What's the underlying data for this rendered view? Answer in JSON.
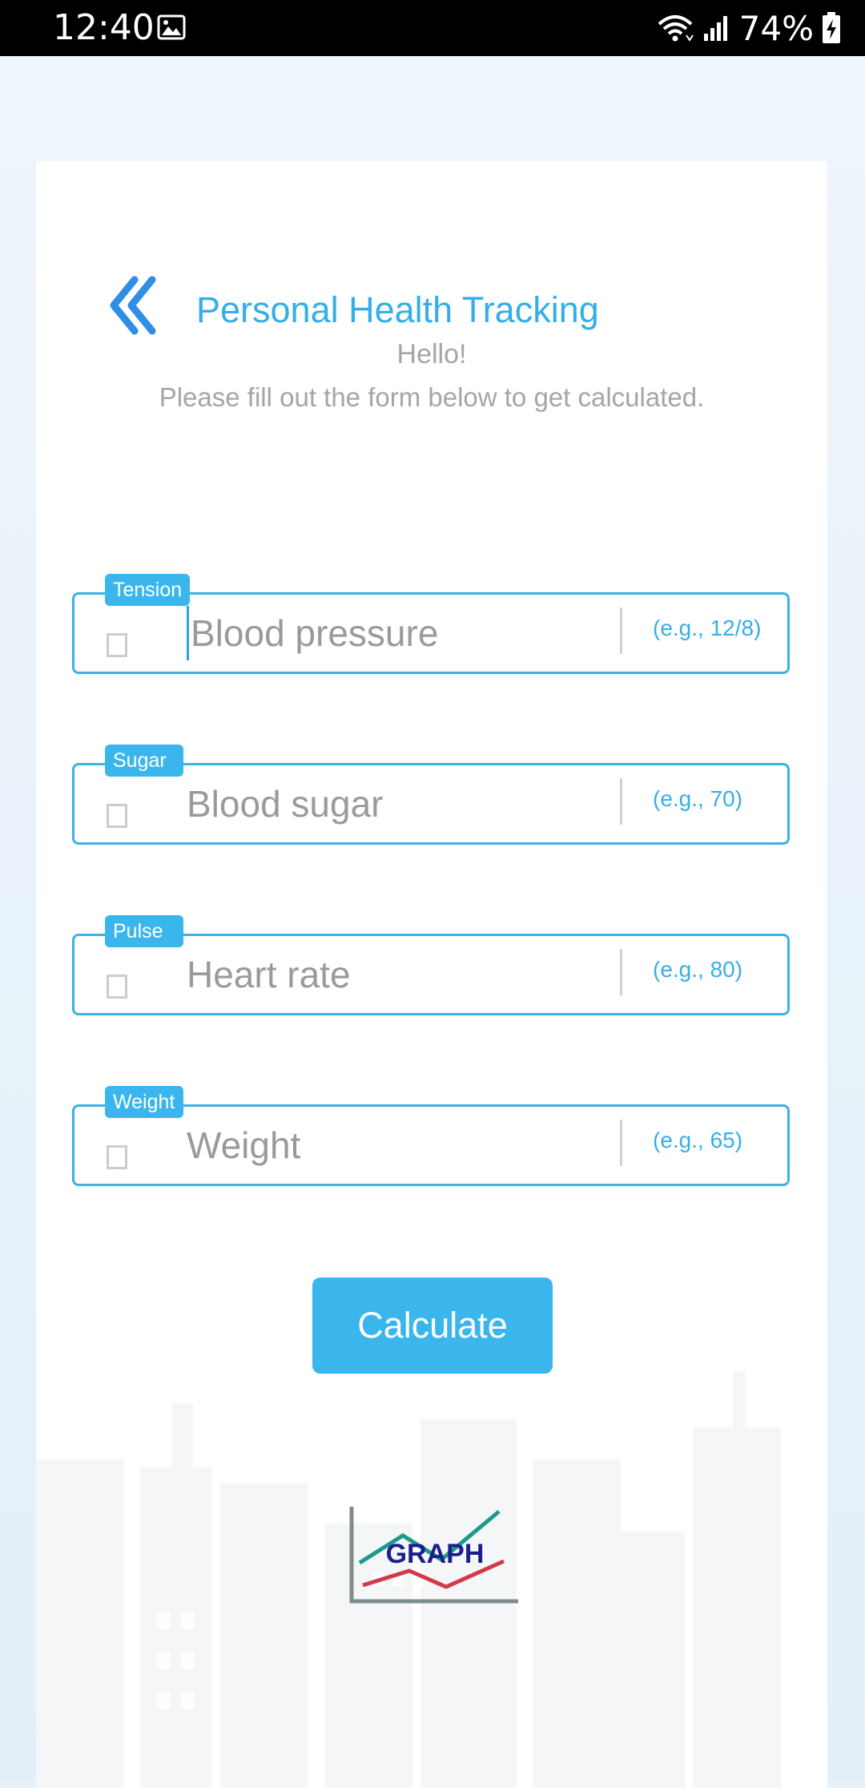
{
  "status_bar": {
    "time": "12:40",
    "battery": "74%",
    "icons": [
      "image-icon",
      "wifi-icon",
      "signal-icon",
      "battery-charging-icon"
    ]
  },
  "header": {
    "back_icon": "double-chevron-left-icon",
    "title": "Personal Health Tracking",
    "greeting": "Hello!",
    "subtitle": "Please fill out the form below to get calculated."
  },
  "form": {
    "fields": [
      {
        "tag": "Tension",
        "placeholder": "Blood pressure",
        "hint": "(e.g., 12/8)"
      },
      {
        "tag": "Sugar",
        "placeholder": "Blood sugar",
        "hint": "(e.g., 70)"
      },
      {
        "tag": "Pulse",
        "placeholder": "Heart rate",
        "hint": "(e.g., 80)"
      },
      {
        "tag": "Weight",
        "placeholder": "Weight",
        "hint": "(e.g., 65)"
      }
    ],
    "submit_label": "Calculate"
  },
  "logo": {
    "text": "GRAPH"
  },
  "colors": {
    "accent": "#3ab6ec",
    "title": "#35aee8",
    "muted_text": "#a5a5a5",
    "logo_text": "#1a1f8c",
    "logo_line_green": "#1a9a8a",
    "logo_line_red": "#d23a4a"
  }
}
